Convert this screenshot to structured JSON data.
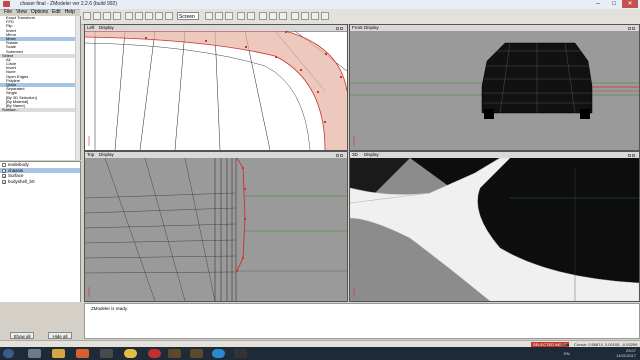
{
  "window": {
    "title": "chaser final - ZModeler ver 2.2.6 (build 992)",
    "minimize": "–",
    "maximize": "□",
    "close": "✕"
  },
  "menu": [
    "File",
    "View",
    "Options",
    "Edit",
    "Help"
  ],
  "toolbar": {
    "screen_select": "Screen"
  },
  "tools_list": {
    "items": [
      {
        "label": "Exact Transform",
        "selected": false,
        "section": false
      },
      {
        "label": "FFD",
        "selected": false,
        "section": false
      },
      {
        "label": "Flip",
        "selected": false,
        "section": false
      },
      {
        "label": "Invert",
        "selected": false,
        "section": false
      },
      {
        "label": "Mirror",
        "selected": false,
        "section": false
      },
      {
        "label": "Move",
        "selected": true,
        "section": false
      },
      {
        "label": "Rotate",
        "selected": false,
        "section": false
      },
      {
        "label": "Scale",
        "selected": false,
        "section": false
      },
      {
        "label": "Submesh",
        "selected": false,
        "section": false
      },
      {
        "label": "Select",
        "selected": false,
        "section": true
      },
      {
        "label": "All",
        "selected": false,
        "section": false
      },
      {
        "label": "Circle",
        "selected": false,
        "section": false
      },
      {
        "label": "Invert",
        "selected": false,
        "section": false
      },
      {
        "label": "None",
        "selected": false,
        "section": false
      },
      {
        "label": "Open Edges",
        "selected": false,
        "section": false
      },
      {
        "label": "Polyline",
        "selected": false,
        "section": false
      },
      {
        "label": "Quick",
        "selected": true,
        "section": false
      },
      {
        "label": "Separated",
        "selected": false,
        "section": false
      },
      {
        "label": "Single",
        "selected": false,
        "section": false
      },
      {
        "label": "[By 3D Selection]",
        "selected": false,
        "section": false
      },
      {
        "label": "[By Material]",
        "selected": false,
        "section": false
      },
      {
        "label": "[By Name]",
        "selected": false,
        "section": false
      },
      {
        "label": "Surface...",
        "selected": false,
        "section": true
      }
    ]
  },
  "layers": {
    "rows": [
      {
        "label": "endeibody",
        "checked": false,
        "selected": false
      },
      {
        "label": "chassis",
        "checked": true,
        "selected": true
      },
      {
        "label": "Surface",
        "checked": true,
        "selected": false
      },
      {
        "label": "bodyshell_b0",
        "checked": true,
        "selected": false
      }
    ],
    "show_all": "Show all",
    "hide_all": "Hide all"
  },
  "viewports": {
    "left": {
      "name": "Left",
      "display": "Display"
    },
    "front": {
      "name": "Front",
      "display": "Display"
    },
    "top": {
      "name": "Top",
      "display": "Display"
    },
    "threed": {
      "name": "3D",
      "display": "Display"
    }
  },
  "console": {
    "message": "ZModeler is ready."
  },
  "status": {
    "mode": "SELECTED MODE",
    "auto": "Auto",
    "cursor": "Cursor: 0.56874, 0.00105, -0.63299"
  },
  "tray": {
    "lang": "EN",
    "time": "23:07",
    "date": "11/01/2017"
  },
  "colors": {
    "selection": "#a8c4e4",
    "selected_vertex": "#d03030",
    "selected_face": "#e6b0a0"
  },
  "icons": [
    "start-icon",
    "alien-icon",
    "folder-icon",
    "media-icon",
    "chrome-icon",
    "opera-icon",
    "zmodeler-icon",
    "photo-icon",
    "skype-icon",
    "player-icon"
  ]
}
